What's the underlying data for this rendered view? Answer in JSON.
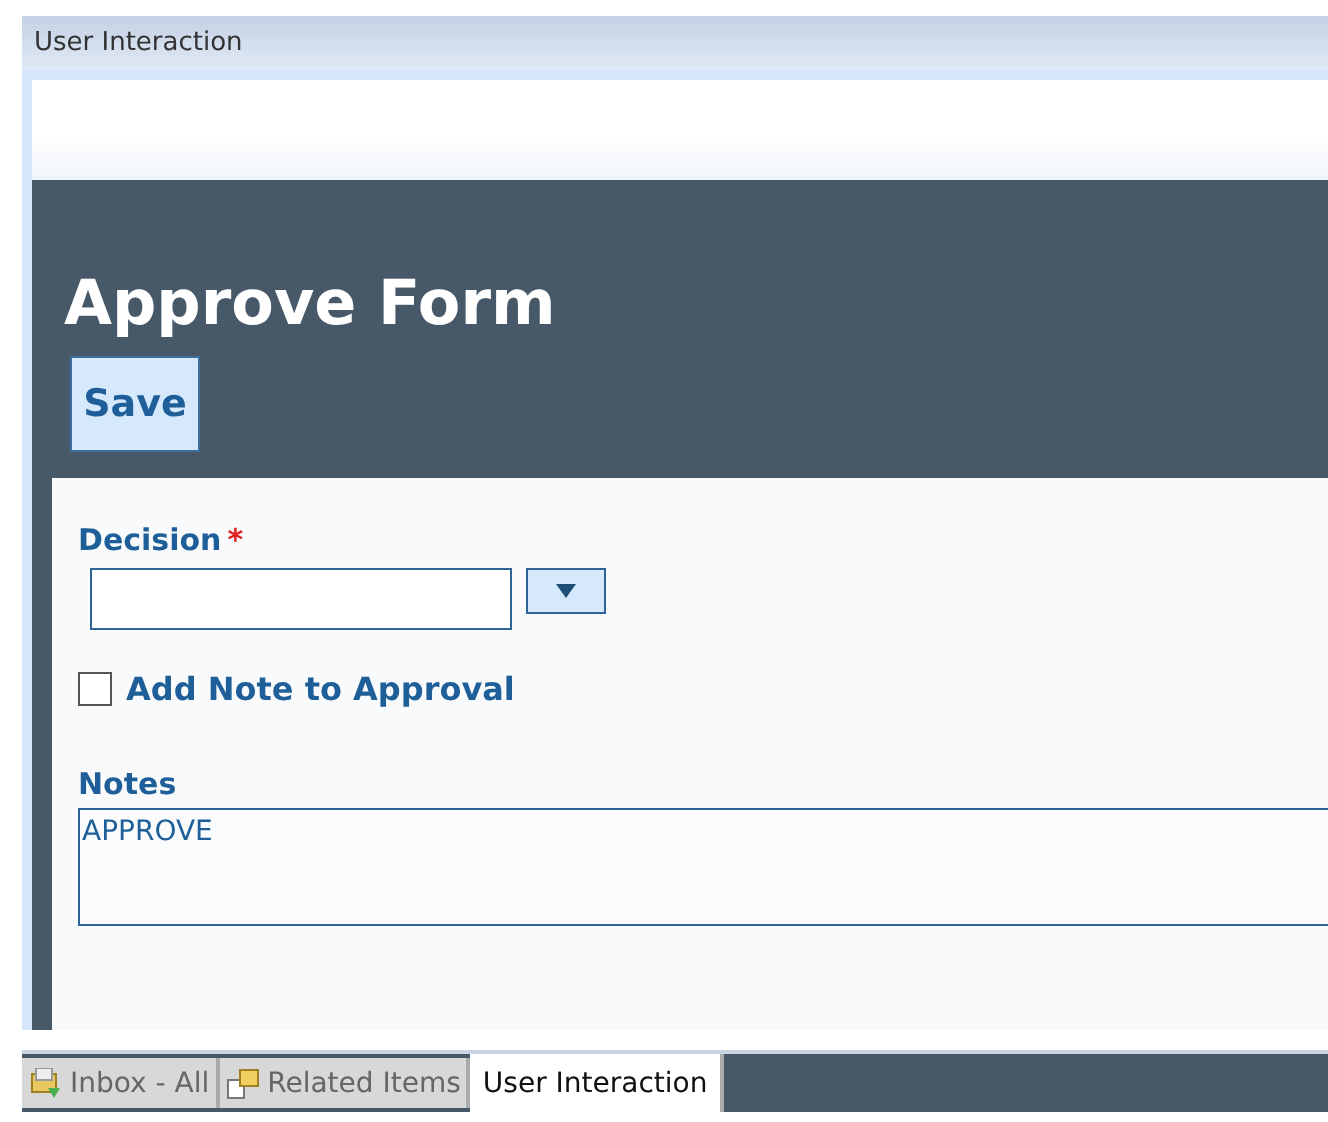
{
  "window": {
    "title": "User Interaction"
  },
  "form": {
    "title": "Approve Form",
    "save_button": "Save",
    "decision": {
      "label": "Decision",
      "required_mark": "*"
    },
    "add_note": {
      "label": "Add Note to Approval",
      "checked": false
    },
    "notes": {
      "label": "Notes",
      "value": "APPROVE"
    }
  },
  "tabs": [
    {
      "label": "Inbox - All",
      "kind": "inbox",
      "selected": false
    },
    {
      "label": "Related Items",
      "kind": "related",
      "selected": false
    },
    {
      "label": "User Interaction",
      "kind": "plain",
      "selected": true
    }
  ]
}
